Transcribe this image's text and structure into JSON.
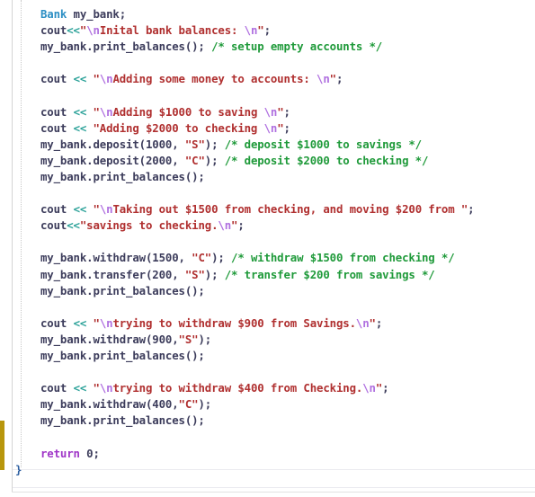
{
  "editor": {
    "language": "cpp",
    "colors": {
      "type": "#2d8fc4",
      "identifier": "#3d3d5c",
      "operator": "#2aa198",
      "string": "#b03030",
      "escape": "#b070e0",
      "comment": "#1f9a3a",
      "keyword": "#a037c8",
      "change_marker": "#b8960c"
    },
    "lines": [
      [
        {
          "k": "type",
          "t": "Bank"
        },
        {
          "k": "plain",
          "t": " my_bank;"
        }
      ],
      [
        {
          "k": "plain",
          "t": "cout"
        },
        {
          "k": "op",
          "t": "<<"
        },
        {
          "k": "str",
          "t": "\""
        },
        {
          "k": "esc",
          "t": "\\n"
        },
        {
          "k": "str",
          "t": "Inital bank balances: "
        },
        {
          "k": "esc",
          "t": "\\n"
        },
        {
          "k": "str",
          "t": "\""
        },
        {
          "k": "plain",
          "t": ";"
        }
      ],
      [
        {
          "k": "plain",
          "t": "my_bank.print_balances(); "
        },
        {
          "k": "com",
          "t": "/* setup empty accounts */"
        }
      ],
      [],
      [
        {
          "k": "plain",
          "t": "cout "
        },
        {
          "k": "op",
          "t": "<<"
        },
        {
          "k": "plain",
          "t": " "
        },
        {
          "k": "str",
          "t": "\""
        },
        {
          "k": "esc",
          "t": "\\n"
        },
        {
          "k": "str",
          "t": "Adding some money to accounts: "
        },
        {
          "k": "esc",
          "t": "\\n"
        },
        {
          "k": "str",
          "t": "\""
        },
        {
          "k": "plain",
          "t": ";"
        }
      ],
      [],
      [
        {
          "k": "plain",
          "t": "cout "
        },
        {
          "k": "op",
          "t": "<<"
        },
        {
          "k": "plain",
          "t": " "
        },
        {
          "k": "str",
          "t": "\""
        },
        {
          "k": "esc",
          "t": "\\n"
        },
        {
          "k": "str",
          "t": "Adding $1000 to saving "
        },
        {
          "k": "esc",
          "t": "\\n"
        },
        {
          "k": "str",
          "t": "\""
        },
        {
          "k": "plain",
          "t": ";"
        }
      ],
      [
        {
          "k": "plain",
          "t": "cout "
        },
        {
          "k": "op",
          "t": "<<"
        },
        {
          "k": "plain",
          "t": " "
        },
        {
          "k": "str",
          "t": "\"Adding $2000 to checking "
        },
        {
          "k": "esc",
          "t": "\\n"
        },
        {
          "k": "str",
          "t": "\""
        },
        {
          "k": "plain",
          "t": ";"
        }
      ],
      [
        {
          "k": "plain",
          "t": "my_bank.deposit(1000, "
        },
        {
          "k": "str",
          "t": "\"S\""
        },
        {
          "k": "plain",
          "t": "); "
        },
        {
          "k": "com",
          "t": "/* deposit $1000 to savings */"
        }
      ],
      [
        {
          "k": "plain",
          "t": "my_bank.deposit(2000, "
        },
        {
          "k": "str",
          "t": "\"C\""
        },
        {
          "k": "plain",
          "t": "); "
        },
        {
          "k": "com",
          "t": "/* deposit $2000 to checking */"
        }
      ],
      [
        {
          "k": "plain",
          "t": "my_bank.print_balances();"
        }
      ],
      [],
      [
        {
          "k": "plain",
          "t": "cout "
        },
        {
          "k": "op",
          "t": "<<"
        },
        {
          "k": "plain",
          "t": " "
        },
        {
          "k": "str",
          "t": "\""
        },
        {
          "k": "esc",
          "t": "\\n"
        },
        {
          "k": "str",
          "t": "Taking out $1500 from checking, and moving $200 from \""
        },
        {
          "k": "plain",
          "t": ";"
        }
      ],
      [
        {
          "k": "plain",
          "t": "cout"
        },
        {
          "k": "op",
          "t": "<<"
        },
        {
          "k": "str",
          "t": "\"savings to checking."
        },
        {
          "k": "esc",
          "t": "\\n"
        },
        {
          "k": "str",
          "t": "\""
        },
        {
          "k": "plain",
          "t": ";"
        }
      ],
      [],
      [
        {
          "k": "plain",
          "t": "my_bank.withdraw(1500, "
        },
        {
          "k": "str",
          "t": "\"C\""
        },
        {
          "k": "plain",
          "t": "); "
        },
        {
          "k": "com",
          "t": "/* withdraw $1500 from checking */"
        }
      ],
      [
        {
          "k": "plain",
          "t": "my_bank.transfer(200, "
        },
        {
          "k": "str",
          "t": "\"S\""
        },
        {
          "k": "plain",
          "t": "); "
        },
        {
          "k": "com",
          "t": "/* transfer $200 from savings */"
        }
      ],
      [
        {
          "k": "plain",
          "t": "my_bank.print_balances();"
        }
      ],
      [],
      [
        {
          "k": "plain",
          "t": "cout "
        },
        {
          "k": "op",
          "t": "<<"
        },
        {
          "k": "plain",
          "t": " "
        },
        {
          "k": "str",
          "t": "\""
        },
        {
          "k": "esc",
          "t": "\\n"
        },
        {
          "k": "str",
          "t": "trying to withdraw $900 from Savings."
        },
        {
          "k": "esc",
          "t": "\\n"
        },
        {
          "k": "str",
          "t": "\""
        },
        {
          "k": "plain",
          "t": ";"
        }
      ],
      [
        {
          "k": "plain",
          "t": "my_bank.withdraw(900,"
        },
        {
          "k": "str",
          "t": "\"S\""
        },
        {
          "k": "plain",
          "t": ");"
        }
      ],
      [
        {
          "k": "plain",
          "t": "my_bank.print_balances();"
        }
      ],
      [],
      [
        {
          "k": "plain",
          "t": "cout "
        },
        {
          "k": "op",
          "t": "<<"
        },
        {
          "k": "plain",
          "t": " "
        },
        {
          "k": "str",
          "t": "\""
        },
        {
          "k": "esc",
          "t": "\\n"
        },
        {
          "k": "str",
          "t": "trying to withdraw $400 from Checking."
        },
        {
          "k": "esc",
          "t": "\\n"
        },
        {
          "k": "str",
          "t": "\""
        },
        {
          "k": "plain",
          "t": ";"
        }
      ],
      [
        {
          "k": "plain",
          "t": "my_bank.withdraw(400,"
        },
        {
          "k": "str",
          "t": "\"C\""
        },
        {
          "k": "plain",
          "t": ");"
        }
      ],
      [
        {
          "k": "plain",
          "t": "my_bank.print_balances();"
        }
      ],
      [],
      [
        {
          "k": "kw",
          "t": "return"
        },
        {
          "k": "plain",
          "t": " 0;"
        }
      ]
    ],
    "closing_line": [
      {
        "k": "brace",
        "t": "}"
      }
    ]
  }
}
